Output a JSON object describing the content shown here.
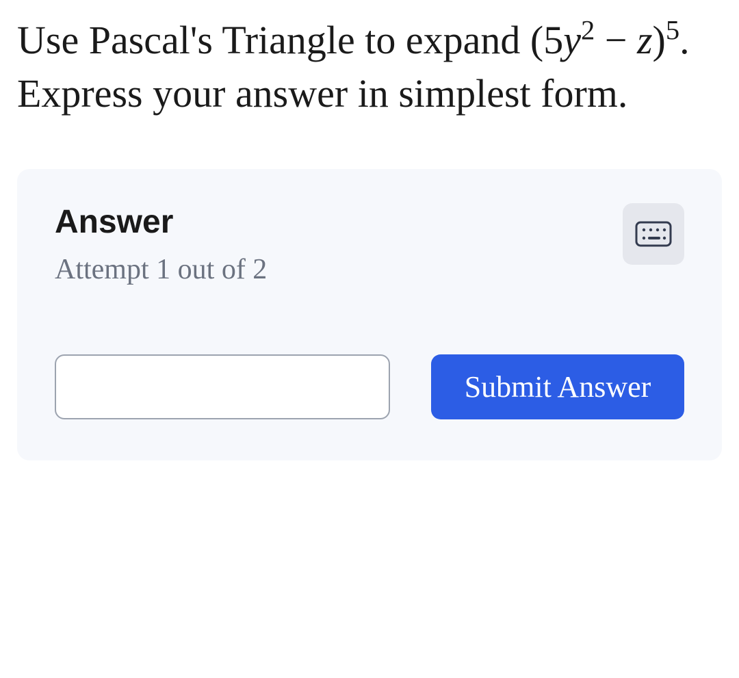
{
  "question": {
    "prefix": "Use Pascal's Triangle to expand ",
    "expression": {
      "open": "(5",
      "var1": "y",
      "exp1": "2",
      "op": " − ",
      "var2": "z",
      "close": ")",
      "exp2": "5"
    },
    "suffix": ". Express your answer in simplest form."
  },
  "answer_box": {
    "title": "Answer",
    "attempt_text": "Attempt 1 out of 2",
    "input_value": "",
    "submit_label": "Submit Answer"
  }
}
